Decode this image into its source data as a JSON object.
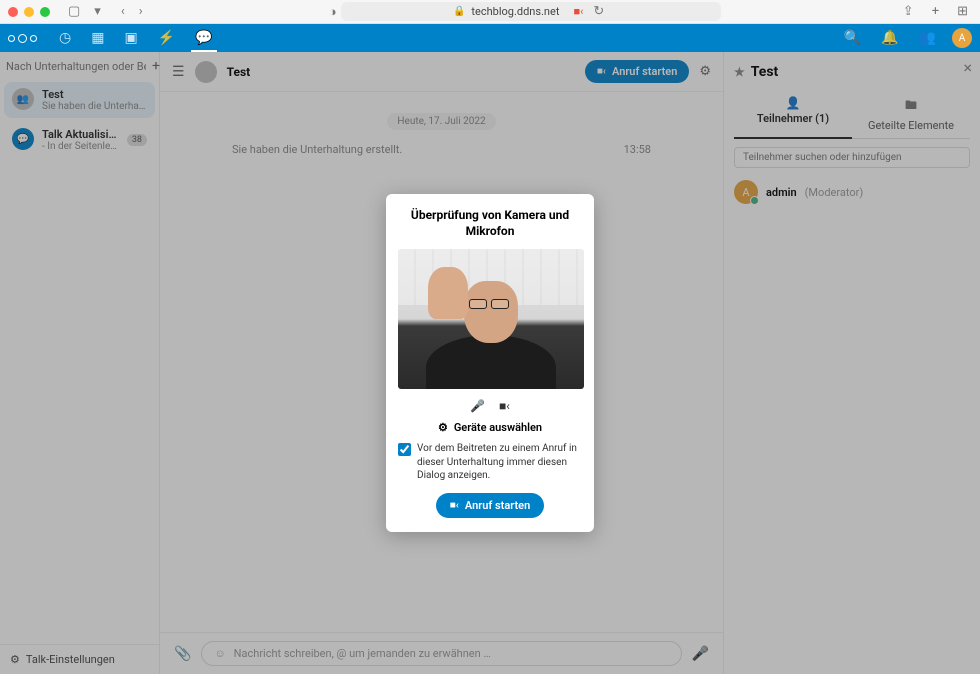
{
  "browser": {
    "url": "techblog.ddns.net",
    "lock": "🔒"
  },
  "sidebar": {
    "search_placeholder": "Nach Unterhaltungen oder Benutze",
    "conversations": [
      {
        "name": "Test",
        "subtitle": "Sie haben die Unterhaltung e…"
      },
      {
        "name": "Talk Aktualisierungen ✅",
        "subtitle": "- In der Seitenleiste fin…",
        "badge": "38"
      }
    ],
    "footer": "Talk-Einstellungen"
  },
  "chat": {
    "title": "Test",
    "start_call": "Anruf starten",
    "date": "Heute, 17. Juli 2022",
    "system_msg": "Sie haben die Unterhaltung erstellt.",
    "system_time": "13:58",
    "input_placeholder": "Nachricht schreiben, @ um jemanden zu erwähnen …"
  },
  "details": {
    "title": "Test",
    "tabs": {
      "participants": "Teilnehmer (1)",
      "shared": "Geteilte Elemente"
    },
    "search_placeholder": "Teilnehmer suchen oder hinzufügen",
    "participant": {
      "name": "admin",
      "role": "(Moderator)",
      "initial": "A"
    }
  },
  "modal": {
    "title": "Überprüfung von Kamera und Mikrofon",
    "devices": "Geräte auswählen",
    "checkbox_text": "Vor dem Beitreten zu einem Anruf in dieser Unterhaltung immer diesen Dialog anzeigen.",
    "start_call": "Anruf starten"
  }
}
